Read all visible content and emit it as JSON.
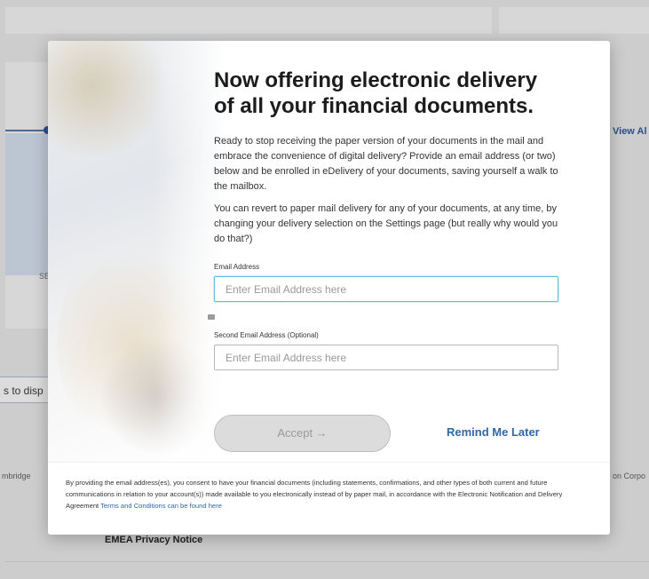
{
  "background": {
    "view_all": "View Al",
    "side_letter": "SE",
    "display_text": "s to disp",
    "cambridge": "mbridge",
    "corp": "on Corpo",
    "emea": "EMEA Privacy Notice"
  },
  "modal": {
    "headline": "Now offering electronic delivery of all your financial documents.",
    "paragraph1": "Ready to stop receiving the paper version of your documents in the mail and embrace the convenience of digital delivery? Provide an email address (or two) below and be enrolled in eDelivery of your documents, saving yourself a walk to the mailbox.",
    "paragraph2": "You can revert to paper mail delivery for any of your documents, at any time, by changing your delivery selection on the Settings page (but really why would you do that?)",
    "email_label": "Email Address",
    "email_placeholder": "Enter Email Address here",
    "email_value": "",
    "second_email_label": "Second Email Address (Optional)",
    "second_email_placeholder": "Enter Email Address here",
    "second_email_value": "",
    "accept_label": "Accept →",
    "remind_label": "Remind Me Later",
    "legal_text": "By providing the email address(es), you consent to have your financial documents (including statements, confirmations, and other types of both current and future communications in relation to your account(s)) made available to you electronically instead of by paper mail, in accordance with the Electronic Notification and Delivery Agreement",
    "terms_link": "Terms and Conditions can be found here"
  },
  "colors": {
    "accent_blue": "#2f67a8",
    "focus_border": "#5fc0d8",
    "accept_disabled": "#dcdcdc"
  }
}
